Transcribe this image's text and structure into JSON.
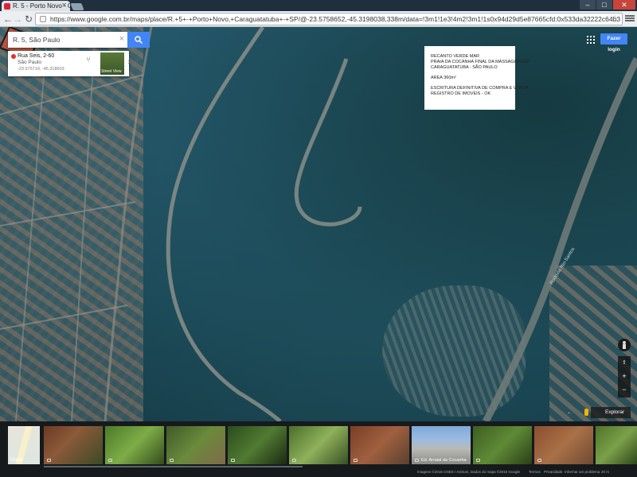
{
  "browser": {
    "tab_title": "R. 5 - Porto Novo - Googl",
    "url": "https://www.google.com.br/maps/place/R.+5+-+Porto+Novo,+Caraguatatuba+-+SP/@-23.5758652,-45.3198038,338m/data=!3m1!1e3!4m2!3m1!1s0x94d29d5e87665cfd:0x533da32222c64b3"
  },
  "search": {
    "value": "R. 5, São Paulo"
  },
  "place_card": {
    "name": "Rua Seis, 2-60",
    "city": "São Paulo",
    "coords": "-23.575719, -45.318603",
    "street_view_label": "Street View"
  },
  "header": {
    "signin_label": "Fazer login"
  },
  "infobox": {
    "line1": "RECANTO VERDE MAR",
    "line2": "PRAIA DA COCANHA FINAL DA MASSAGUASSÚ",
    "line3": "CARAGUATATUBA - SÃO PAULO",
    "line4": "AREA 360m²",
    "line5": "ESCRITURA DEFINITIVA DE COMPRA E VENDA",
    "line6": "REGISTRO DE IMOVEIS - OK"
  },
  "map": {
    "road_label": "Rodovia Rio-Santos"
  },
  "controls": {
    "zoom_in": "+",
    "zoom_out": "−",
    "explore_label": "Explorar"
  },
  "filmstrip": {
    "map_label": "Mapa",
    "photo_caption": "Ed. Arraial da Cocanha"
  },
  "footer": {
    "attribution": "Imagens ©2016 CNES / Astrium, Dados do mapa ©2016 Google",
    "terms": "Termos",
    "privacy": "Privacidade",
    "report": "Informar um problema",
    "scale": "20 m"
  },
  "colors": {
    "accent": "#4285f4",
    "parcel": "#c8503c",
    "forest": "#1f5060"
  }
}
